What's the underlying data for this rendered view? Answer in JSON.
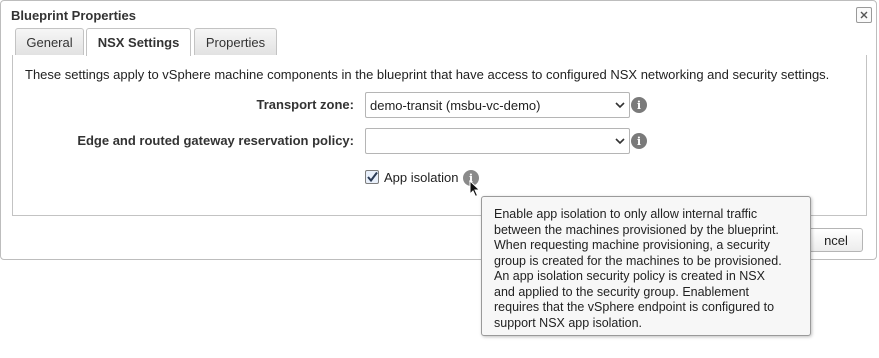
{
  "dialog": {
    "title": "Blueprint Properties",
    "close_icon": "close-icon"
  },
  "tabs": [
    {
      "label": "General",
      "active": false
    },
    {
      "label": "NSX Settings",
      "active": true
    },
    {
      "label": "Properties",
      "active": false
    }
  ],
  "panel": {
    "intro": "These settings apply to vSphere machine components in the blueprint that have access to configured NSX networking and security settings.",
    "transport_zone": {
      "label": "Transport zone:",
      "value": "demo-transit (msbu-vc-demo)"
    },
    "edge_policy": {
      "label": "Edge and routed gateway reservation policy:",
      "value": ""
    },
    "app_isolation": {
      "label": "App isolation",
      "checked": true
    }
  },
  "footer": {
    "cancel_visible_text": "ncel"
  },
  "tooltip": {
    "lines": [
      "Enable app isolation to only allow internal traffic",
      "between the machines provisioned by the blueprint.",
      "When requesting machine provisioning, a security",
      "group is created for the machines to be provisioned.",
      "An app isolation security policy is created in NSX",
      "and applied to the security group. Enablement",
      "requires that the vSphere endpoint is configured to",
      "support NSX app isolation."
    ]
  },
  "colors": {
    "tab_border": "#c3c3c3",
    "info_icon": "#7a7a7a",
    "tooltip_bg": "#f7f7f7"
  }
}
